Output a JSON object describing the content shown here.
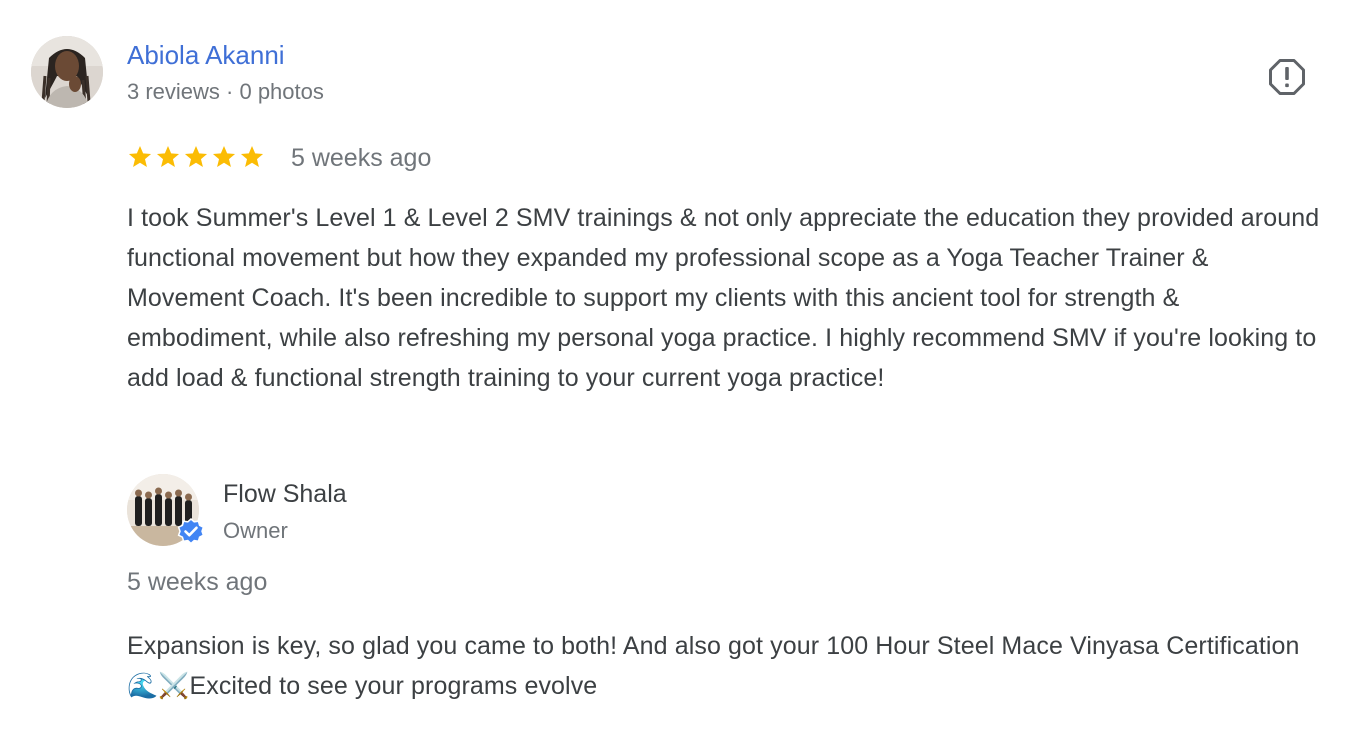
{
  "reviewer": {
    "name": "Abiola Akanni",
    "meta": "3 reviews · 0 photos",
    "avatar_icon": "reviewer-avatar-photo"
  },
  "review": {
    "rating": 5,
    "rating_max": 5,
    "star_color": "#fbbc04",
    "date": "5 weeks ago",
    "text": "I took Summer's Level 1 & Level 2 SMV trainings & not only appreciate the education they provided around functional movement but how they expanded my professional scope as a Yoga Teacher Trainer & Movement Coach. It's been incredible to support my clients with this ancient tool for strength & embodiment, while also refreshing my personal yoga practice. I highly recommend SMV if you're looking to add load & functional strength training to your current yoga practice!"
  },
  "owner_reply": {
    "name": "Flow Shala",
    "role": "Owner",
    "date": "5 weeks ago",
    "text": "Expansion is key, so glad you came to both! And also got your 100 Hour Steel Mace Vinyasa Certification 🌊⚔️Excited to see your programs evolve",
    "badge_color": "#4285f4"
  },
  "actions": {
    "flag_icon": "report-flag-icon"
  },
  "colors": {
    "link_blue": "#3f6fd6",
    "text_dark": "#3c4043",
    "text_muted": "#70757a"
  }
}
